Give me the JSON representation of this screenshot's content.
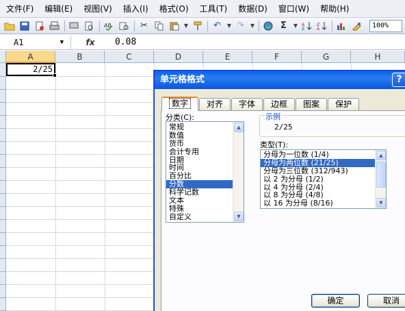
{
  "menubar": {
    "items": [
      "文件(F)",
      "编辑(E)",
      "视图(V)",
      "插入(I)",
      "格式(O)",
      "工具(T)",
      "数据(D)",
      "窗口(W)",
      "帮助(H)"
    ]
  },
  "toolbar": {
    "zoom": "100%",
    "sigma": "Σ"
  },
  "formula_bar": {
    "name_box": "A1",
    "fx": "fx",
    "value": "0.08"
  },
  "sheet": {
    "columns": [
      "A",
      "B",
      "C",
      "D",
      "E",
      "F",
      "G",
      "H"
    ],
    "selected_column": "A",
    "cell_a1": "2/25"
  },
  "dialog": {
    "title": "单元格格式",
    "help": "?",
    "tabs": [
      "数字",
      "对齐",
      "字体",
      "边框",
      "图案",
      "保护"
    ],
    "active_tab": "数字",
    "category_label": "分类(C):",
    "categories": [
      "常规",
      "数值",
      "货币",
      "会计专用",
      "日期",
      "时间",
      "百分比",
      "分数",
      "科学记数",
      "文本",
      "特殊",
      "自定义"
    ],
    "selected_category": "分数",
    "sample_label": "示例",
    "sample_value": "2/25",
    "type_label": "类型(T):",
    "types": [
      "分母为一位数 (1/4)",
      "分母为两位数 (21/25)",
      "分母为三位数 (312/943)",
      "以 2 为分母 (1/2)",
      "以 4 为分母 (2/4)",
      "以 8 为分母 (4/8)",
      "以 16 为分母 (8/16)"
    ],
    "selected_type": "分母为两位数 (21/25)",
    "ok_label": "确定",
    "cancel_label": "取消"
  },
  "colors": {
    "titlebar": "#0a5fe6",
    "selection": "#316ac5",
    "column_highlight": "#f9d98b",
    "dialog_bg": "#ece9d8"
  }
}
